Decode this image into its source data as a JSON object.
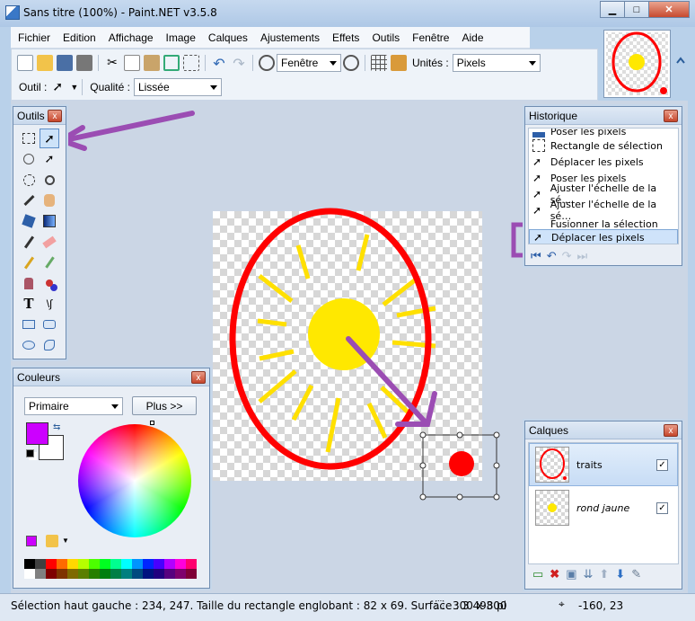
{
  "window": {
    "title": "Sans titre (100%) - Paint.NET v3.5.8"
  },
  "menu": [
    "Fichier",
    "Edition",
    "Affichage",
    "Image",
    "Calques",
    "Ajustements",
    "Effets",
    "Outils",
    "Fenêtre",
    "Aide"
  ],
  "toolbar": {
    "zoom_value": "Fenêtre",
    "units_label": "Unités :",
    "units_value": "Pixels",
    "tool_label": "Outil :",
    "quality_label": "Qualité :",
    "quality_value": "Lissée"
  },
  "tools_panel": {
    "title": "Outils",
    "close": "x"
  },
  "colors_panel": {
    "title": "Couleurs",
    "close": "x",
    "mode": "Primaire",
    "more_button": "Plus >>",
    "primary_color": "#cc00ff",
    "secondary_color": "#ffffff"
  },
  "history_panel": {
    "title": "Historique",
    "close": "x",
    "items": [
      "Poser les pixels",
      "Rectangle de sélection",
      "Déplacer les pixels",
      "Poser les pixels",
      "Ajuster l'échelle de la sé…",
      "Ajuster l'échelle de la sé…",
      "Fusionner la sélection",
      "Déplacer les pixels"
    ]
  },
  "layers_panel": {
    "title": "Calques",
    "close": "x",
    "layers": [
      {
        "name": "traits",
        "checked": "✓"
      },
      {
        "name": "rond jaune",
        "checked": "✓"
      }
    ]
  },
  "status": {
    "text": "Sélection haut gauche : 234, 247. Taille du rectangle englobant : 82 x 69. Surface : 3 498 pi",
    "image_size": "300 x 300",
    "cursor": "-160, 23"
  },
  "colors": {
    "accent_annotation": "#9b4db3",
    "ellipse": "#ff0000",
    "sun": "#ffe800"
  }
}
